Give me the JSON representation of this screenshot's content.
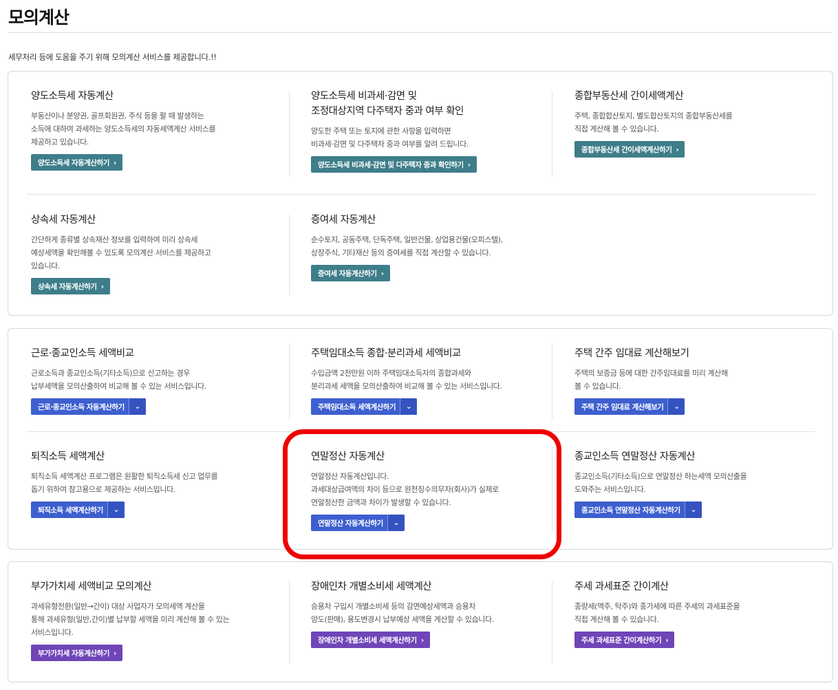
{
  "page": {
    "title": "모의계산",
    "intro": "세무처리 등에 도움을 주기 위해 모의계산 서비스를 제공합니다.!!"
  },
  "groups": [
    {
      "cards": [
        {
          "title": "양도소득세 자동계산",
          "desc": "부동산이나 분양권, 골프회원권, 주식 등을 팔 때 발생하는\n소득에 대하여 과세하는 양도소득세의 자동세액계산 서비스를\n제공하고 있습니다.",
          "button": "양도소득세 자동계산하기",
          "arrow": "›"
        },
        {
          "title": "양도소득세 비과세·감면 및\n조정대상지역 다주택자 중과 여부 확인",
          "desc": "양도한 주택 또는 토지에 관한 사항을 입력하면\n비과세·감면 및 다주택자 중과 여부를 알려 드립니다.",
          "button": "양도소득세 비과세·감면 및 다주택자 중과 확인하기",
          "arrow": "›"
        },
        {
          "title": "종합부동산세 간이세액계산",
          "desc": "주택, 종합합산토지, 별도합산토지의 종합부동산세를\n직접 계산해 볼 수 있습니다.",
          "button": "종합부동산세 간이세액계산하기",
          "arrow": "›"
        },
        {
          "title": "상속세 자동계산",
          "desc": "간단하게 종류별 상속재산 정보를 입력하여 미리 상속세\n예상세액을 확인해볼 수 있도록 모의계산 서비스를 제공하고\n있습니다.",
          "button": "상속세 자동계산하기",
          "arrow": "›"
        },
        {
          "title": "증여세 자동계산",
          "desc": "순수토지, 공동주택, 단독주택, 일반건물, 상업용건물(오피스텔),\n상장주식, 기타재산 등의 증여세를 직접 계산할 수 있습니다.",
          "button": "증여세 자동계산하기",
          "arrow": "›"
        }
      ]
    },
    {
      "cards": [
        {
          "title": "근로·종교인소득 세액비교",
          "desc": "근로소득과 종교인소득(기타소득)으로 신고하는 경우\n납부세액을 모의산출하여 비교해 볼 수 있는 서비스입니다.",
          "button": "근로·종교인소득 자동계산하기",
          "drop": "⌄"
        },
        {
          "title": "주택임대소득 종합·분리과세 세액비교",
          "desc": "수입금액 2천만원 이하 주택임대소득자의 종합과세와\n분리과세 세액을 모의산출하여 비교해 볼 수 있는 서비스입니다.",
          "button": "주택임대소득 세액계산하기",
          "drop": "⌄"
        },
        {
          "title": "주택 간주 임대료 계산해보기",
          "desc": "주택의 보증금 등에 대한 간주임대료를 미리 계산해\n볼 수 있습니다.",
          "button": "주택 간주 임대료 계산해보기",
          "drop": "⌄"
        },
        {
          "title": "퇴직소득 세액계산",
          "desc": "퇴직소득 세액계산 프로그램은 원활한 퇴직소득세 신고 업무를\n돕기 위하여 참고용으로 제공하는 서비스입니다.",
          "button": "퇴직소득 세액계산하기",
          "drop": "⌄"
        },
        {
          "title": "연말정산 자동계산",
          "desc": "연말정산 자동계산입니다.\n과세대상급여액의 차이 등으로 원천징수의무자(회사)가 실제로\n연말정산한 금액과 차이가 발생할 수 있습니다.",
          "button": "연말정산 자동계산하기",
          "drop": "⌄"
        },
        {
          "title": "종교인소득 연말정산 자동계산",
          "desc": "종교인소득(기타소득)으로 연말정산 하는세액 모의산출을\n도와주는 서비스입니다.",
          "button": "종교인소득 연말정산 자동계산하기",
          "drop": "⌄"
        }
      ]
    },
    {
      "cards": [
        {
          "title": "부가가치세 세액비교 모의계산",
          "desc": "과세유형전환(일반→간이) 대상 사업자가 모의세액 계산을\n통해 과세유형(일반,간이)별 납부할 세액을 미리 계산해 볼 수 있는\n서비스입니다.",
          "button": "부가가치세 자동계산하기",
          "arrow": "›"
        },
        {
          "title": "장애인차 개별소비세 세액계산",
          "desc": "승용차 구입시 개별소비세 등의 감면예상세액과 승용차\n양도(판매), 용도변경시 납부예상 세액을 계산할 수 있습니다.",
          "button": "장애인차 개별소비세 세액계산하기",
          "arrow": "›"
        },
        {
          "title": "주세 과세표준 간이계산",
          "desc": "종량세(맥주, 탁주)와 종가세에 따른 주세의 과세표준을\n직접 계산해 볼 수 있습니다.",
          "button": "주세 과세표준 간이계산하기",
          "arrow": "›"
        }
      ]
    }
  ],
  "colors": {
    "teal": "#3e7e8a",
    "blue": "#3d5fcf",
    "purple": "#6f45b8",
    "highlight": "#ee0000"
  }
}
